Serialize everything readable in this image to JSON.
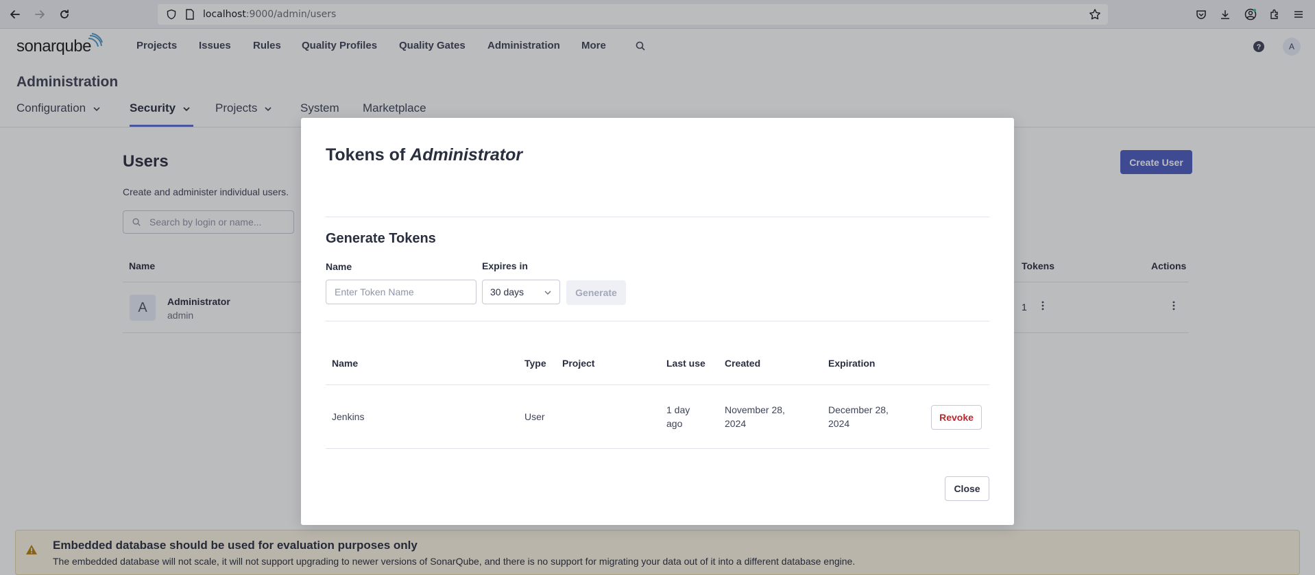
{
  "browser": {
    "url_host": "localhost",
    "url_path": ":9000/admin/users"
  },
  "header": {
    "logo": "sonarqube",
    "nav": [
      "Projects",
      "Issues",
      "Rules",
      "Quality Profiles",
      "Quality Gates",
      "Administration",
      "More"
    ],
    "avatar_letter": "A"
  },
  "admin": {
    "title": "Administration",
    "tabs": [
      {
        "label": "Configuration",
        "has_dropdown": true
      },
      {
        "label": "Security",
        "has_dropdown": true,
        "active": true
      },
      {
        "label": "Projects",
        "has_dropdown": true
      },
      {
        "label": "System",
        "has_dropdown": false
      },
      {
        "label": "Marketplace",
        "has_dropdown": false
      }
    ]
  },
  "users": {
    "title": "Users",
    "description": "Create and administer individual users.",
    "search_placeholder": "Search by login or name...",
    "create_button": "Create User",
    "columns": {
      "name": "Name",
      "tokens": "Tokens",
      "actions": "Actions"
    },
    "rows": [
      {
        "avatar": "A",
        "name": "Administrator",
        "login": "admin",
        "tokens": "1"
      }
    ]
  },
  "modal": {
    "title_prefix": "Tokens of",
    "title_user": "Administrator",
    "generate_title": "Generate Tokens",
    "name_label": "Name",
    "name_placeholder": "Enter Token Name",
    "expires_label": "Expires in",
    "expires_value": "30 days",
    "generate_button": "Generate",
    "columns": {
      "name": "Name",
      "type": "Type",
      "project": "Project",
      "last_use": "Last use",
      "created": "Created",
      "expiration": "Expiration"
    },
    "tokens": [
      {
        "name": "Jenkins",
        "type": "User",
        "project": "",
        "last_use_1": "1 day",
        "last_use_2": "ago",
        "created_1": "November 28,",
        "created_2": "2024",
        "expiration_1": "December 28,",
        "expiration_2": "2024",
        "action": "Revoke"
      }
    ],
    "close_button": "Close"
  },
  "warning": {
    "title": "Embedded database should be used for evaluation purposes only",
    "text": "The embedded database will not scale, it will not support upgrading to newer versions of SonarQube, and there is no support for migrating your data out of it into a different database engine."
  },
  "colors": {
    "accent": "#4c5ec0",
    "revoke": "#c0262d",
    "warning_bg": "#fcf5e4"
  }
}
